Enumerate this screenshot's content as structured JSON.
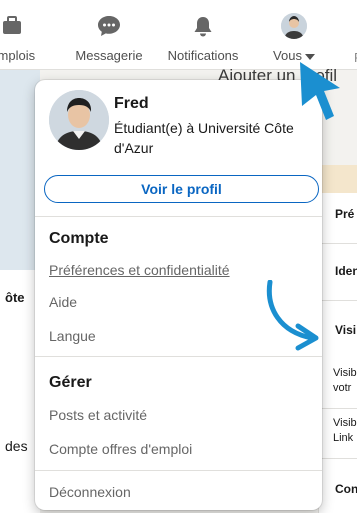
{
  "nav": {
    "items": [
      {
        "label": "Emplois",
        "icon": "briefcase-icon"
      },
      {
        "label": "Messagerie",
        "icon": "chat-bubble-icon"
      },
      {
        "label": "Notifications",
        "icon": "bell-icon"
      },
      {
        "label": "Vous",
        "icon": "avatar"
      }
    ],
    "right_cut_label": "P"
  },
  "background": {
    "title": "Ajouter un profil",
    "left_fragment_1": "ôte",
    "left_fragment_2": "des",
    "settings_items": [
      "Pré",
      "Iden",
      "Visi",
      "Con"
    ],
    "settings_sub": [
      "Visib",
      "votr",
      "Visib",
      "Link"
    ]
  },
  "dropdown": {
    "name": "Fred",
    "headline": "Étudiant(e) à Université Côte d'Azur",
    "view_profile": "Voir le profil",
    "account": {
      "title": "Compte",
      "items": [
        "Préférences et confidentialité",
        "Aide",
        "Langue"
      ]
    },
    "manage": {
      "title": "Gérer",
      "items": [
        "Posts et activité",
        "Compte offres d'emploi"
      ]
    },
    "signout": "Déconnexion"
  },
  "colors": {
    "accent": "#0a66c2",
    "cursor": "#1b8fd0"
  }
}
